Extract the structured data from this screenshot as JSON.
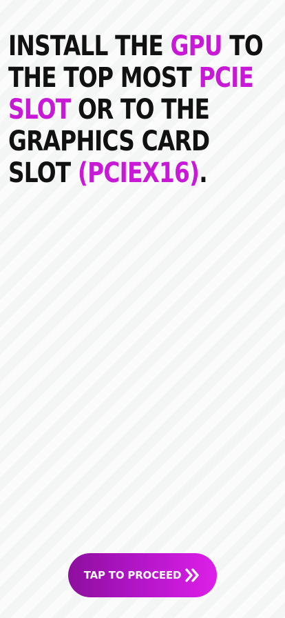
{
  "instruction": {
    "part1": "Install the ",
    "highlight1": "GPU",
    "part2": " to the top most ",
    "highlight2": "PCIe slot",
    "part3": " or to the graphics card slot ",
    "highlight3": "(PCIex16)",
    "part4": "."
  },
  "cta": {
    "label": "TAP TO PROCEED",
    "icon": "double-chevron-right-icon"
  },
  "colors": {
    "highlight": "#c81ad6",
    "text": "#111111",
    "button_gradient_start": "#8e0f9e",
    "button_gradient_end": "#dd1fe8",
    "background": "#f6f7f7"
  }
}
